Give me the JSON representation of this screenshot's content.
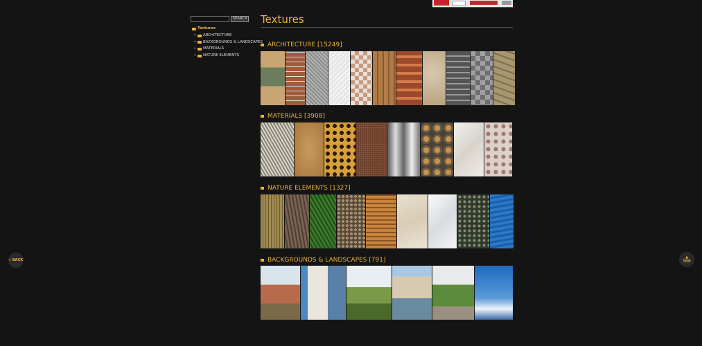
{
  "search": {
    "value": "",
    "button": "SEARCH"
  },
  "tree": {
    "root": "Textures",
    "items": [
      "ARCHITECTURE",
      "BACKGROUNDS & LANDSCAPES",
      "MATERIALS",
      "NATURE ELEMENTS"
    ]
  },
  "page": {
    "title": "Textures"
  },
  "sections": [
    {
      "title": "ARCHITECTURE [15249]"
    },
    {
      "title": "MATERIALS [3908]"
    },
    {
      "title": "NATURE ELEMENTS [1327]"
    },
    {
      "title": "BACKGROUNDS & LANDSCAPES [791]"
    }
  ],
  "nav": {
    "back": "« BACK",
    "top_arrow": "▲",
    "top": "TOP"
  },
  "colors": {
    "accent": "#e8b343",
    "background": "#151414"
  }
}
